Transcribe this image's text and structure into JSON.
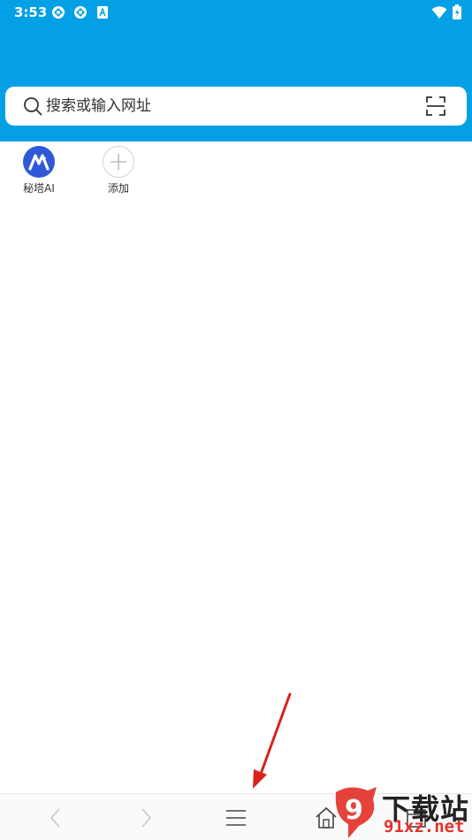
{
  "status_bar": {
    "time": "3:53"
  },
  "search": {
    "placeholder": "搜索或输入网址"
  },
  "shortcuts": [
    {
      "label": "秘塔AI"
    },
    {
      "label": "添加"
    }
  ],
  "watermark": {
    "brand": "下载站",
    "url": "91xz.net",
    "number": "9"
  },
  "colors": {
    "header_bg": "#03a0e6",
    "arrow": "#d9221c",
    "shortcut_mita": "#2f59d6"
  }
}
